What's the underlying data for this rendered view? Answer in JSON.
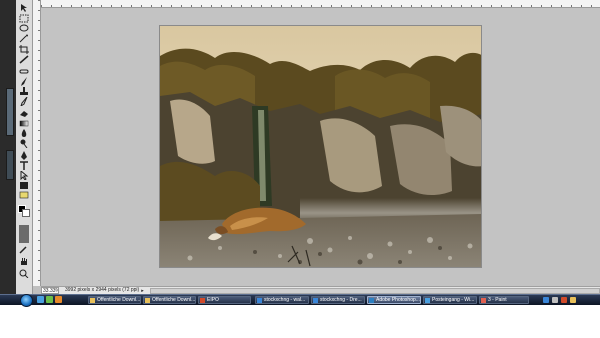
{
  "window": {
    "title": ""
  },
  "status_bar": {
    "zoom": "33.33%",
    "doc_info": "3992 pixels x 2944 pixels (72 ppi)"
  },
  "tools": [
    {
      "name": "move-tool-icon"
    },
    {
      "name": "marquee-tool-icon"
    },
    {
      "name": "lasso-tool-icon"
    },
    {
      "name": "magic-wand-tool-icon"
    },
    {
      "name": "crop-tool-icon"
    },
    {
      "name": "slice-tool-icon"
    },
    {
      "name": "healing-brush-tool-icon"
    },
    {
      "name": "brush-tool-icon"
    },
    {
      "name": "clone-stamp-tool-icon"
    },
    {
      "name": "history-brush-tool-icon"
    },
    {
      "name": "eraser-tool-icon"
    },
    {
      "name": "gradient-tool-icon"
    },
    {
      "name": "blur-tool-icon"
    },
    {
      "name": "dodge-tool-icon"
    },
    {
      "name": "pen-tool-icon"
    },
    {
      "name": "type-tool-icon"
    },
    {
      "name": "path-selection-tool-icon"
    },
    {
      "name": "shape-tool-icon"
    },
    {
      "name": "notes-tool-icon"
    },
    {
      "name": "eyedropper-tool-icon"
    },
    {
      "name": "hand-tool-icon"
    },
    {
      "name": "zoom-tool-icon"
    }
  ],
  "colors": {
    "foreground": "#000000",
    "background": "#ffffff",
    "taskbar": "#1b2740"
  },
  "taskbar": {
    "items": [
      {
        "label": "Öffentliche Downl...",
        "icon_color": "#e8c05a",
        "icon": "folder-icon"
      },
      {
        "label": "Öffentliche Downl...",
        "icon_color": "#e8c05a",
        "icon": "folder-icon"
      },
      {
        "label": "EIPO",
        "icon_color": "#d04a2a",
        "icon": "app-icon"
      },
      {
        "label": "stockxchng - wal...",
        "icon_color": "#3a86d8",
        "icon": "browser-icon"
      },
      {
        "label": "stockxchng - Dre...",
        "icon_color": "#3a86d8",
        "icon": "browser-icon"
      },
      {
        "label": "Adobe Photoshop...",
        "icon_color": "#2c7fc1",
        "icon": "photoshop-icon"
      },
      {
        "label": "Posteingang - Wi...",
        "icon_color": "#4aa0e0",
        "icon": "mail-icon"
      },
      {
        "label": "3 - Paint",
        "icon_color": "#e06050",
        "icon": "paint-icon"
      }
    ]
  }
}
